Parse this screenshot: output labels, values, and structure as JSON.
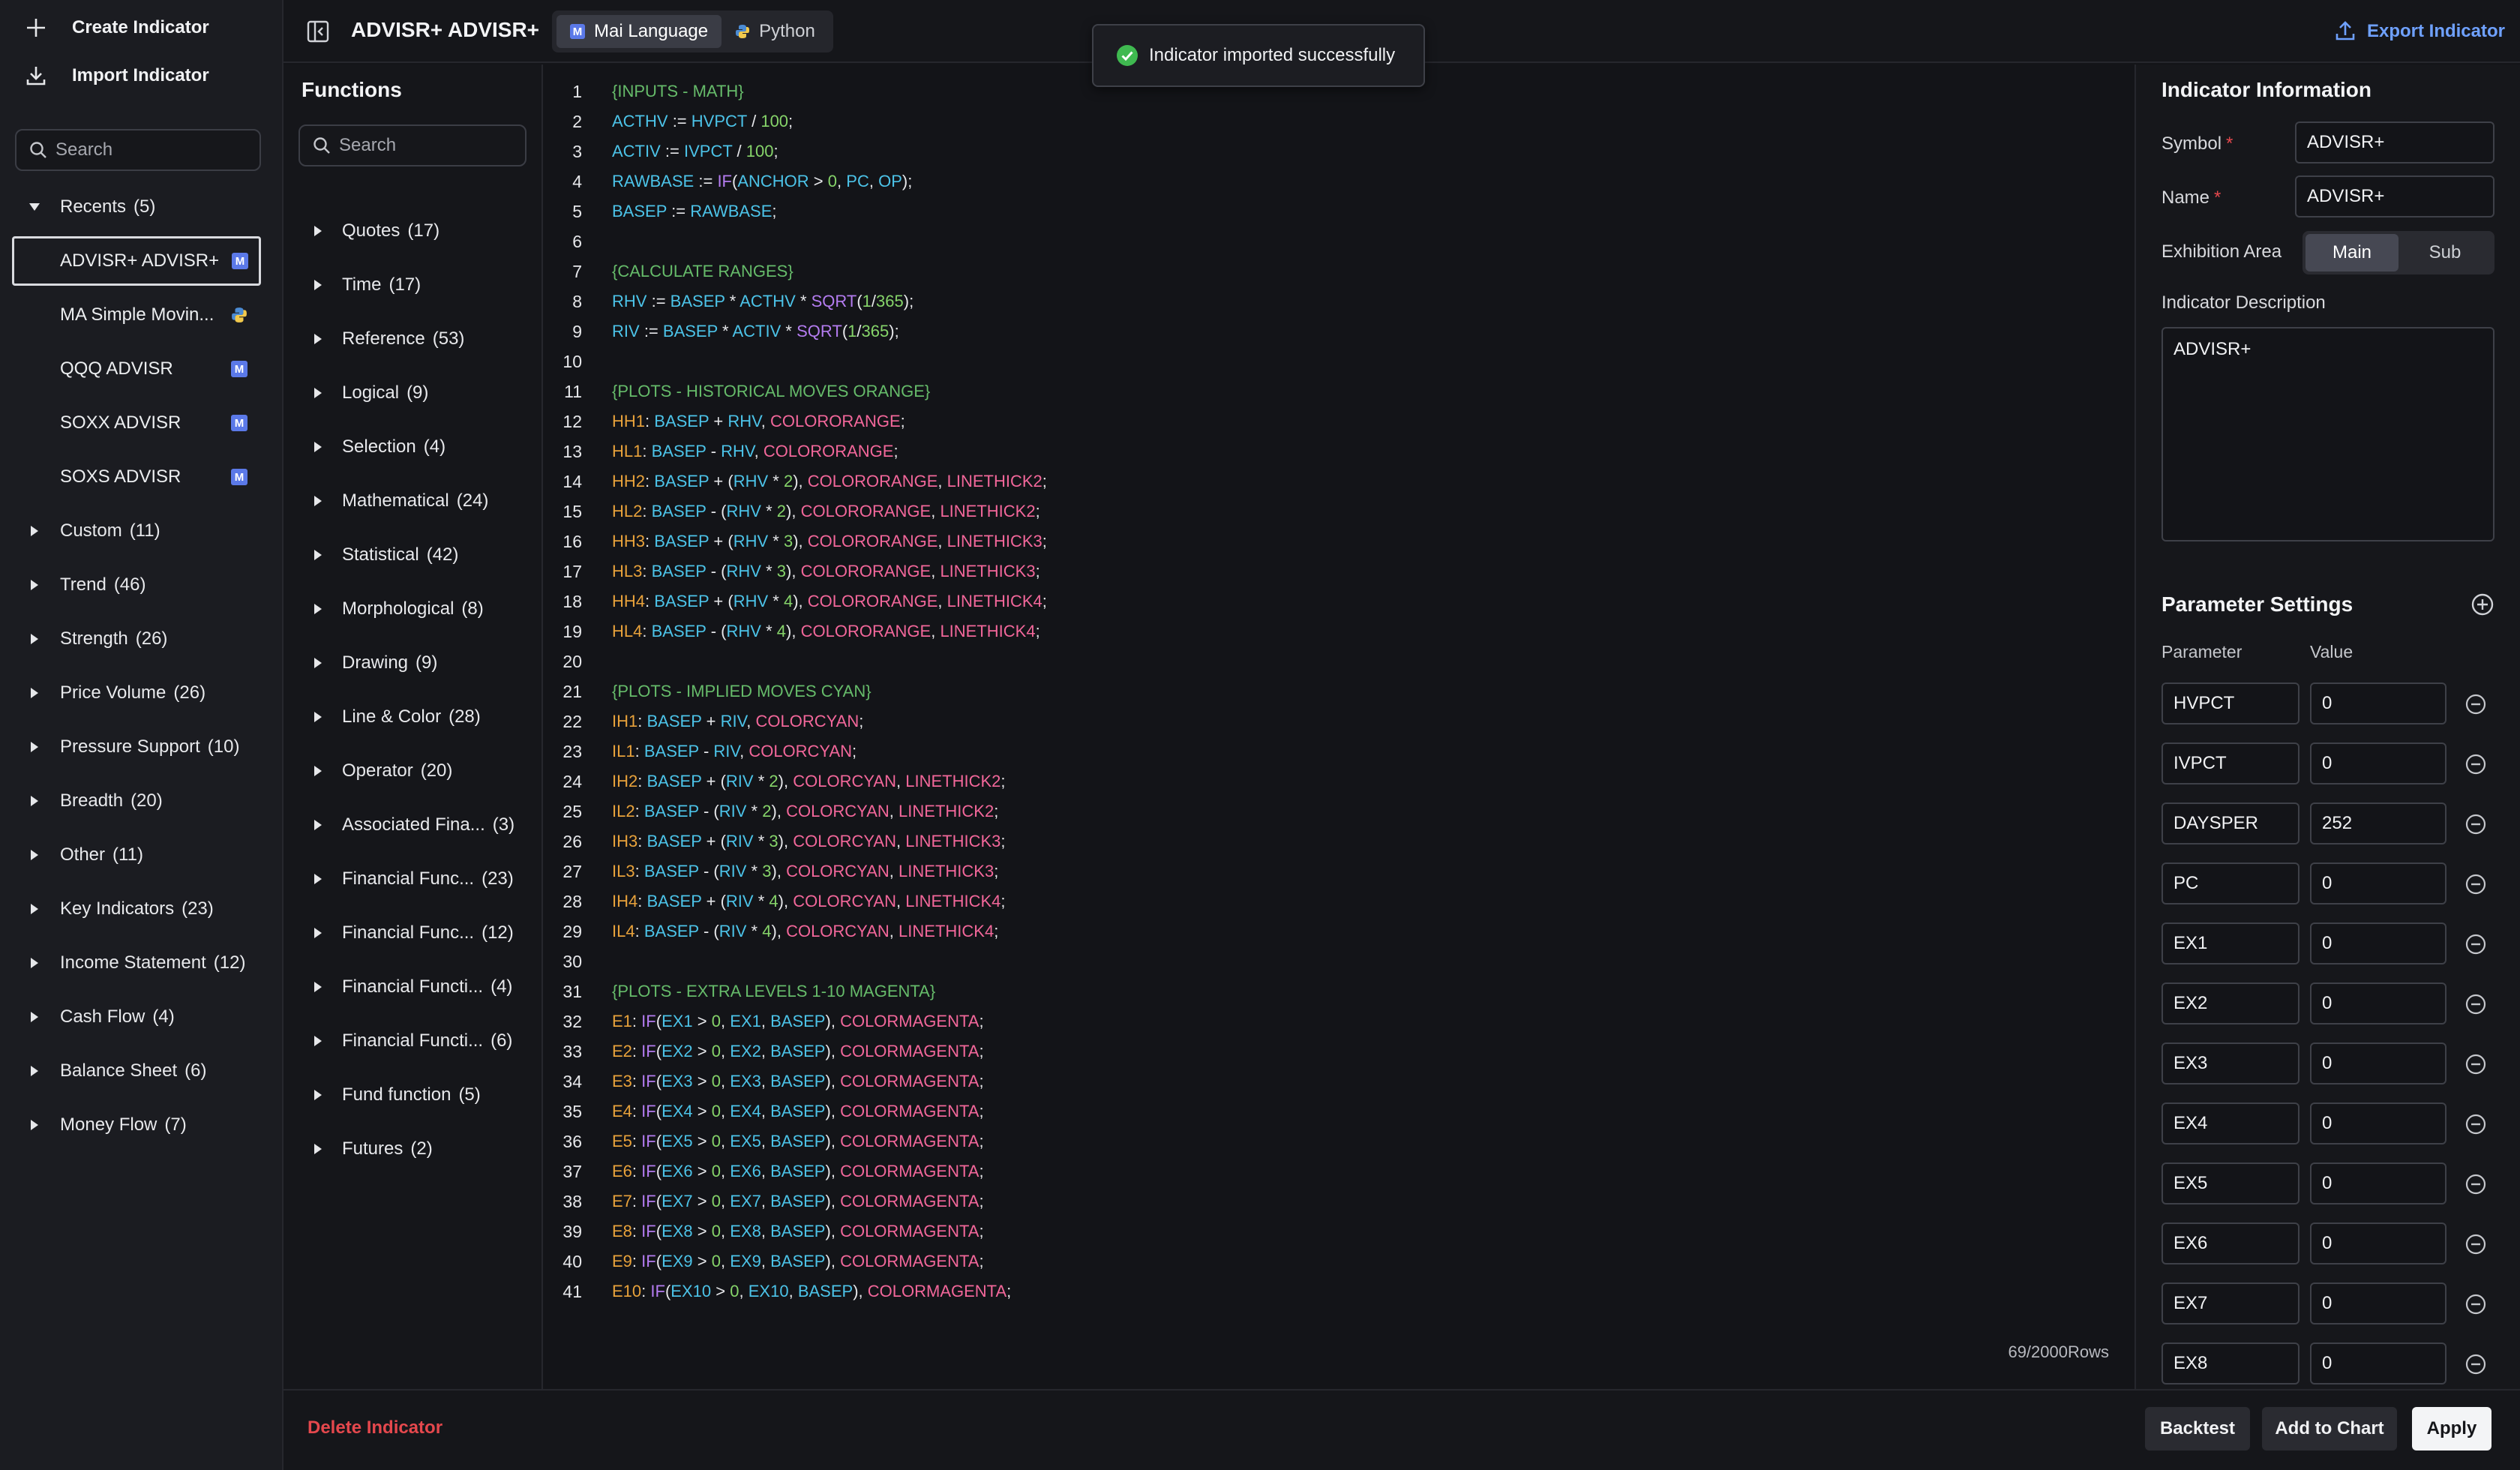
{
  "sidebar": {
    "create_label": "Create Indicator",
    "import_label": "Import Indicator",
    "search_placeholder": "Search",
    "recents": {
      "label": "Recents",
      "count": "(5)"
    },
    "recent_items": [
      {
        "label": "ADVISR+ ADVISR+",
        "badge": "M"
      },
      {
        "label": "MA Simple Movin...",
        "badge": "py"
      },
      {
        "label": "QQQ ADVISR",
        "badge": "M"
      },
      {
        "label": "SOXX ADVISR",
        "badge": "M"
      },
      {
        "label": "SOXS ADVISR",
        "badge": "M"
      }
    ],
    "groups": [
      {
        "label": "Custom",
        "count": "(11)"
      },
      {
        "label": "Trend",
        "count": "(46)"
      },
      {
        "label": "Strength",
        "count": "(26)"
      },
      {
        "label": "Price Volume",
        "count": "(26)"
      },
      {
        "label": "Pressure Support",
        "count": "(10)"
      },
      {
        "label": "Breadth",
        "count": "(20)"
      },
      {
        "label": "Other",
        "count": "(11)"
      },
      {
        "label": "Key Indicators",
        "count": "(23)"
      },
      {
        "label": "Income Statement",
        "count": "(12)"
      },
      {
        "label": "Cash Flow",
        "count": "(4)"
      },
      {
        "label": "Balance Sheet",
        "count": "(6)"
      },
      {
        "label": "Money Flow",
        "count": "(7)"
      }
    ]
  },
  "topbar": {
    "title": "ADVISR+ ADVISR+",
    "tabs": [
      {
        "label": "Mai Language",
        "icon": "mai-icon",
        "active": true
      },
      {
        "label": "Python",
        "icon": "python-icon",
        "active": false
      }
    ],
    "export_label": "Export Indicator"
  },
  "toast": {
    "message": "Indicator imported successfully"
  },
  "functions": {
    "title": "Functions",
    "search_placeholder": "Search",
    "items": [
      {
        "label": "Quotes",
        "count": "(17)"
      },
      {
        "label": "Time",
        "count": "(17)"
      },
      {
        "label": "Reference",
        "count": "(53)"
      },
      {
        "label": "Logical",
        "count": "(9)"
      },
      {
        "label": "Selection",
        "count": "(4)"
      },
      {
        "label": "Mathematical",
        "count": "(24)"
      },
      {
        "label": "Statistical",
        "count": "(42)"
      },
      {
        "label": "Morphological",
        "count": "(8)"
      },
      {
        "label": "Drawing",
        "count": "(9)"
      },
      {
        "label": "Line & Color",
        "count": "(28)"
      },
      {
        "label": "Operator",
        "count": "(20)"
      },
      {
        "label": "Associated Fina...",
        "count": "(3)"
      },
      {
        "label": "Financial Func...",
        "count": "(23)"
      },
      {
        "label": "Financial Func...",
        "count": "(12)"
      },
      {
        "label": "Financial Functi...",
        "count": "(4)"
      },
      {
        "label": "Financial Functi...",
        "count": "(6)"
      },
      {
        "label": "Fund function",
        "count": "(5)"
      },
      {
        "label": "Futures",
        "count": "(2)"
      }
    ]
  },
  "editor": {
    "lines": [
      "{INPUTS - MATH}",
      "ACTHV := HVPCT / 100;",
      "ACTIV := IVPCT / 100;",
      "RAWBASE := IF(ANCHOR > 0, PC, OP);",
      "BASEP := RAWBASE;",
      "",
      "{CALCULATE RANGES}",
      "RHV := BASEP * ACTHV * SQRT(1/365);",
      "RIV := BASEP * ACTIV * SQRT(1/365);",
      "",
      "{PLOTS - HISTORICAL MOVES ORANGE}",
      "HH1: BASEP + RHV, COLORORANGE;",
      "HL1: BASEP - RHV, COLORORANGE;",
      "HH2: BASEP + (RHV * 2), COLORORANGE, LINETHICK2;",
      "HL2: BASEP - (RHV * 2), COLORORANGE, LINETHICK2;",
      "HH3: BASEP + (RHV * 3), COLORORANGE, LINETHICK3;",
      "HL3: BASEP - (RHV * 3), COLORORANGE, LINETHICK3;",
      "HH4: BASEP + (RHV * 4), COLORORANGE, LINETHICK4;",
      "HL4: BASEP - (RHV * 4), COLORORANGE, LINETHICK4;",
      "",
      "{PLOTS - IMPLIED MOVES CYAN}",
      "IH1: BASEP + RIV, COLORCYAN;",
      "IL1: BASEP - RIV, COLORCYAN;",
      "IH2: BASEP + (RIV * 2), COLORCYAN, LINETHICK2;",
      "IL2: BASEP - (RIV * 2), COLORCYAN, LINETHICK2;",
      "IH3: BASEP + (RIV * 3), COLORCYAN, LINETHICK3;",
      "IL3: BASEP - (RIV * 3), COLORCYAN, LINETHICK3;",
      "IH4: BASEP + (RIV * 4), COLORCYAN, LINETHICK4;",
      "IL4: BASEP - (RIV * 4), COLORCYAN, LINETHICK4;",
      "",
      "{PLOTS - EXTRA LEVELS 1-10 MAGENTA}",
      "E1: IF(EX1 > 0, EX1, BASEP), COLORMAGENTA;",
      "E2: IF(EX2 > 0, EX2, BASEP), COLORMAGENTA;",
      "E3: IF(EX3 > 0, EX3, BASEP), COLORMAGENTA;",
      "E4: IF(EX4 > 0, EX4, BASEP), COLORMAGENTA;",
      "E5: IF(EX5 > 0, EX5, BASEP), COLORMAGENTA;",
      "E6: IF(EX6 > 0, EX6, BASEP), COLORMAGENTA;",
      "E7: IF(EX7 > 0, EX7, BASEP), COLORMAGENTA;",
      "E8: IF(EX8 > 0, EX8, BASEP), COLORMAGENTA;",
      "E9: IF(EX9 > 0, EX9, BASEP), COLORMAGENTA;",
      "E10: IF(EX10 > 0, EX10, BASEP), COLORMAGENTA;"
    ],
    "rows_count": "69/2000Rows"
  },
  "info": {
    "title": "Indicator Information",
    "symbol_label": "Symbol",
    "symbol_value": "ADVISR+",
    "name_label": "Name",
    "name_value": "ADVISR+",
    "required_mark": "*",
    "exhibition_label": "Exhibition Area",
    "exhibition_options": [
      "Main",
      "Sub"
    ],
    "description_label": "Indicator Description",
    "description_value": "ADVISR+",
    "params_title": "Parameter Settings",
    "param_col": "Parameter",
    "value_col": "Value",
    "params": [
      {
        "name": "HVPCT",
        "value": "0"
      },
      {
        "name": "IVPCT",
        "value": "0"
      },
      {
        "name": "DAYSPER",
        "value": "252"
      },
      {
        "name": "PC",
        "value": "0"
      },
      {
        "name": "EX1",
        "value": "0"
      },
      {
        "name": "EX2",
        "value": "0"
      },
      {
        "name": "EX3",
        "value": "0"
      },
      {
        "name": "EX4",
        "value": "0"
      },
      {
        "name": "EX5",
        "value": "0"
      },
      {
        "name": "EX6",
        "value": "0"
      },
      {
        "name": "EX7",
        "value": "0"
      },
      {
        "name": "EX8",
        "value": "0"
      }
    ]
  },
  "bottombar": {
    "delete_label": "Delete Indicator",
    "backtest_label": "Backtest",
    "add_chart_label": "Add to Chart",
    "apply_label": "Apply"
  },
  "colors": {
    "accent": "#6fa1ff",
    "danger": "#e5484d",
    "success": "#3fb950",
    "comment": "#66bb6a",
    "variable": "#e8a23b",
    "identifier": "#4cc3e8",
    "number": "#86d46a",
    "function": "#b47cf0",
    "color_const": "#f2679a"
  }
}
